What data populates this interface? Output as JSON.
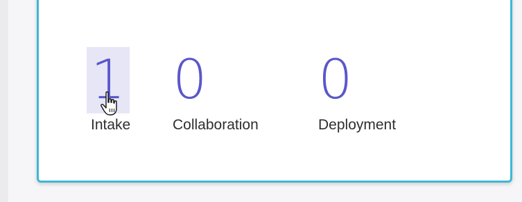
{
  "stats": [
    {
      "value": "1",
      "label": "Intake"
    },
    {
      "value": "0",
      "label": "Collaboration"
    },
    {
      "value": "0",
      "label": "Deployment"
    }
  ],
  "colors": {
    "accent_border": "#3db8d6",
    "number_color": "#5b57c9",
    "highlight_bg": "#e6e6f7"
  },
  "icons": {
    "cursor": "hand-pointer-icon"
  }
}
